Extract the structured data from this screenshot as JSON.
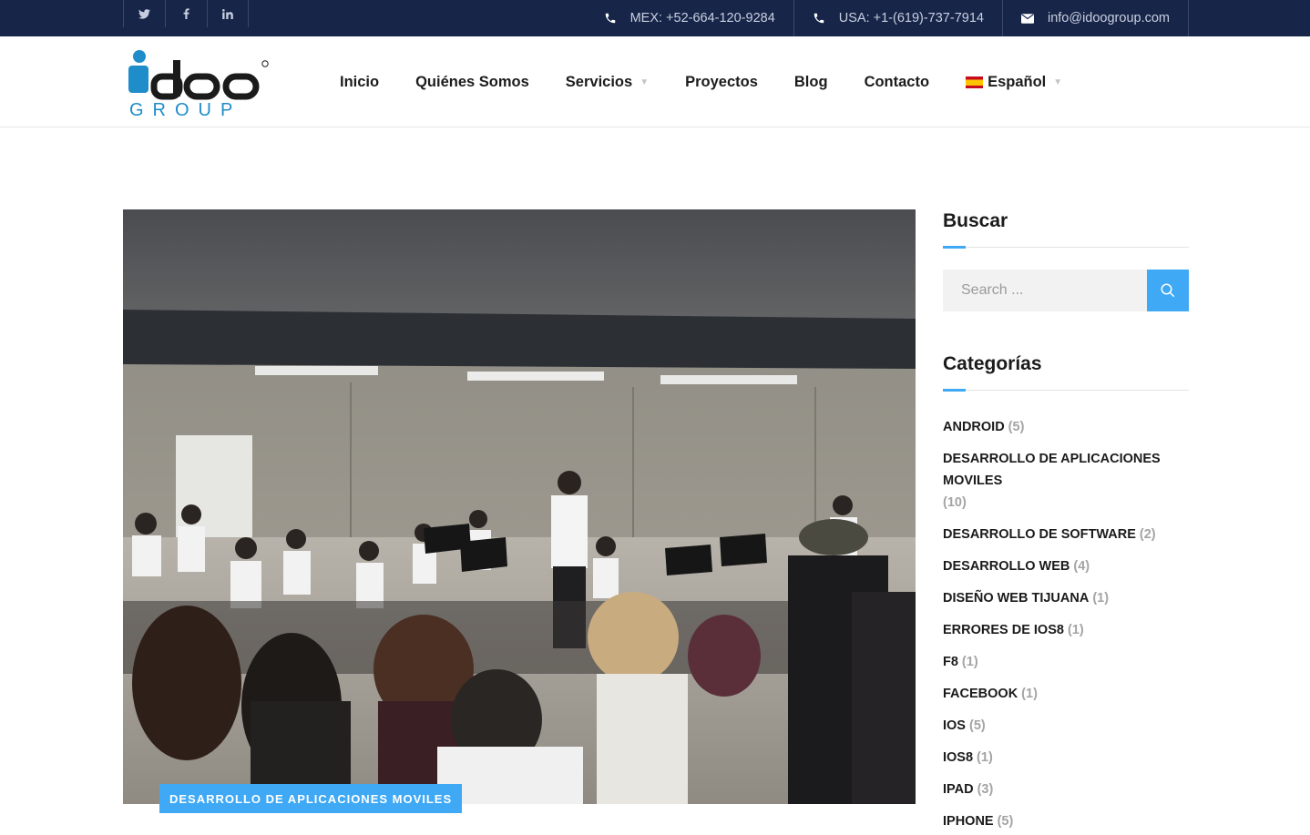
{
  "topbar": {
    "social": [
      {
        "icon": "twitter-icon",
        "glyph": "𝕥"
      },
      {
        "icon": "facebook-icon",
        "glyph": "f"
      },
      {
        "icon": "linkedin-icon",
        "glyph": "in"
      }
    ],
    "contact": [
      {
        "icon": "phone-icon",
        "text": "MEX: +52-664-120-9284"
      },
      {
        "icon": "phone-icon",
        "text": "USA: +1-(619)-737-7914"
      },
      {
        "icon": "envelope-icon",
        "text": "info@idoogroup.com"
      }
    ]
  },
  "header": {
    "logo": {
      "main": "idoo",
      "sub": "GROUP",
      "mark": "®",
      "color": "#1e8dc9"
    },
    "nav": [
      {
        "label": "Inicio",
        "dropdown": false
      },
      {
        "label": "Quiénes Somos",
        "dropdown": false
      },
      {
        "label": "Servicios",
        "dropdown": true
      },
      {
        "label": "Proyectos",
        "dropdown": false
      },
      {
        "label": "Blog",
        "dropdown": false
      },
      {
        "label": "Contacto",
        "dropdown": false
      }
    ],
    "language": {
      "label": "Español",
      "flag": "spain-flag-icon",
      "dropdown": true
    },
    "caret": "▼"
  },
  "post": {
    "category_badge": "DESARROLLO DE APLICACIONES MOVILES",
    "image": "orchestra-rehearsal-photo"
  },
  "sidebar": {
    "search": {
      "title": "Buscar",
      "placeholder": "Search ..."
    },
    "categories": {
      "title": "Categorías",
      "items": [
        {
          "name": "ANDROID",
          "count": "(5)"
        },
        {
          "name": "DESARROLLO DE APLICACIONES MOVILES",
          "count": "(10)"
        },
        {
          "name": "DESARROLLO DE SOFTWARE",
          "count": "(2)"
        },
        {
          "name": "DESARROLLO WEB",
          "count": "(4)"
        },
        {
          "name": "DISEÑO WEB TIJUANA",
          "count": "(1)"
        },
        {
          "name": "ERRORES DE IOS8",
          "count": "(1)"
        },
        {
          "name": "F8",
          "count": "(1)"
        },
        {
          "name": "FACEBOOK",
          "count": "(1)"
        },
        {
          "name": "IOS",
          "count": "(5)"
        },
        {
          "name": "IOS8",
          "count": "(1)"
        },
        {
          "name": "IPAD",
          "count": "(3)"
        },
        {
          "name": "IPHONE",
          "count": "(5)"
        }
      ]
    }
  },
  "colors": {
    "topbar": "#172549",
    "accent": "#3fa9f5",
    "logo": "#1e8dc9"
  }
}
